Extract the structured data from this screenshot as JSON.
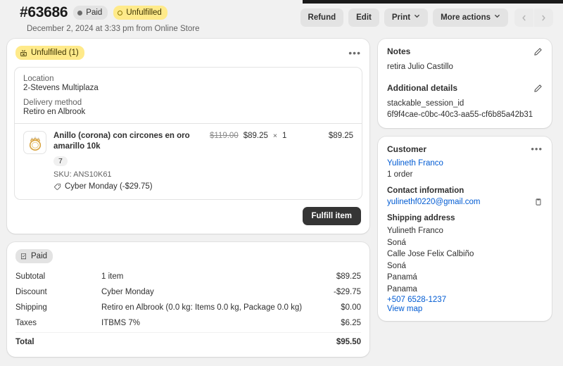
{
  "header": {
    "back_icon": "arrow-left-icon",
    "order_number": "#63686",
    "status_paid": "Paid",
    "status_fulfillment": "Unfulfilled",
    "timestamp": "December 2, 2024 at 3:33 pm from Online Store",
    "actions": {
      "refund": "Refund",
      "edit": "Edit",
      "print": "Print",
      "more_actions": "More actions",
      "prev": "‹",
      "next": "›"
    }
  },
  "fulfillment": {
    "badge": "Unfulfilled (1)",
    "menu_icon": "ellipsis-icon",
    "location_label": "Location",
    "location_value": "2-Stevens Multiplaza",
    "delivery_label": "Delivery method",
    "delivery_value": "Retiro en Albrook",
    "item": {
      "image_icon": "ring-thumbnail",
      "title": "Anillo (corona) con circones en oro amarillo 10k",
      "compare_price": "$119.00",
      "price": "$89.25",
      "times": "×",
      "quantity": "1",
      "line_total": "$89.25",
      "variant": "7",
      "sku": "SKU: ANS10K61",
      "discount": "Cyber Monday (-$29.75)"
    },
    "fulfill_button": "Fulfill item"
  },
  "payment": {
    "badge": "Paid",
    "rows": [
      {
        "label": "Subtotal",
        "desc": "1 item",
        "amount": "$89.25"
      },
      {
        "label": "Discount",
        "desc": "Cyber Monday",
        "amount": "-$29.75"
      },
      {
        "label": "Shipping",
        "desc": "Retiro en Albrook (0.0 kg: Items 0.0 kg, Package 0.0 kg)",
        "amount": "$0.00"
      },
      {
        "label": "Taxes",
        "desc": "ITBMS 7%",
        "amount": "$6.25"
      },
      {
        "label": "Total",
        "desc": "",
        "amount": "$95.50"
      }
    ]
  },
  "notes": {
    "title": "Notes",
    "edit_icon": "pencil-icon",
    "body": "retira Julio Castillo"
  },
  "additional_details": {
    "title": "Additional details",
    "edit_icon": "pencil-icon",
    "key": "stackable_session_id",
    "value": "6f9f4cae-c0bc-40c3-aa55-cf6b85a42b31"
  },
  "customer": {
    "title": "Customer",
    "menu_icon": "ellipsis-icon",
    "name": "Yulineth Franco",
    "orders": "1 order",
    "contact_title": "Contact information",
    "email": "yulinethf0220@gmail.com",
    "copy_icon": "clipboard-icon",
    "shipping_title": "Shipping address",
    "address_lines": [
      "Yulineth Franco",
      "Soná",
      "Calle Jose Felix Calbiño",
      "Soná",
      "Panamá",
      "Panama"
    ],
    "phone": "+507 6528-1237",
    "view_map": "View map"
  },
  "colors": {
    "accent_link": "#005bd3",
    "badge_yellow": "#ffea8a",
    "badge_gray": "#e3e3e3",
    "primary_button": "#353535",
    "page_bg": "#f1f1f1"
  }
}
